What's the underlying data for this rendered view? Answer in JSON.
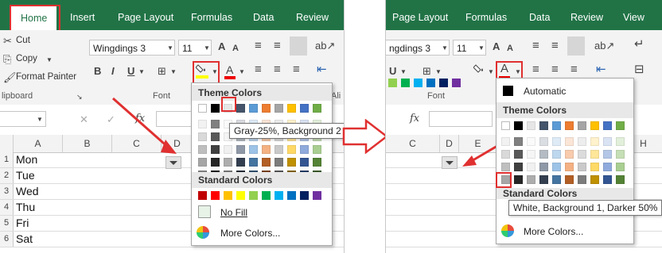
{
  "left": {
    "tabs": [
      "Home",
      "Insert",
      "Page Layout",
      "Formulas",
      "Data",
      "Review"
    ],
    "ribbon": {
      "cut": "Cut",
      "copy": "Copy",
      "format_painter": "Format Painter",
      "font_name": "Wingdings 3",
      "font_size": "11",
      "group_clipboard": "lipboard",
      "group_font": "Font",
      "group_align": "Ali"
    },
    "formula_bar": {
      "fx": "fx"
    },
    "columns": [
      "A",
      "B",
      "C",
      "D"
    ],
    "rows": [
      {
        "num": "1",
        "value": "Mon"
      },
      {
        "num": "2",
        "value": "Tue"
      },
      {
        "num": "3",
        "value": "Wed"
      },
      {
        "num": "4",
        "value": "Thu"
      },
      {
        "num": "5",
        "value": "Fri"
      },
      {
        "num": "6",
        "value": "Sat"
      }
    ],
    "fill_menu": {
      "theme_header": "Theme Colors",
      "standard_header": "Standard Colors",
      "no_fill": "No Fill",
      "more_colors": "More Colors...",
      "tooltip": "Gray-25%, Background 2"
    }
  },
  "right": {
    "tabs": [
      "Page Layout",
      "Formulas",
      "Data",
      "Review",
      "View"
    ],
    "ribbon": {
      "font_name": "ngdings 3",
      "font_size": "11",
      "group_font": "Font"
    },
    "formula_bar": {
      "fx": "fx"
    },
    "columns": [
      "C",
      "D",
      "E",
      "H"
    ],
    "font_menu": {
      "automatic": "Automatic",
      "theme_header": "Theme Colors",
      "standard_header": "Standard Colors",
      "more_colors": "More Colors...",
      "tooltip": "White, Background 1, Darker 50%"
    }
  },
  "colors": {
    "ribbon_green": "#217346",
    "highlight_red": "#e03030",
    "theme_base": [
      "#ffffff",
      "#000000",
      "#e7e6e6",
      "#44546a",
      "#5b9bd5",
      "#ed7d31",
      "#a5a5a5",
      "#ffc000",
      "#4472c4",
      "#70ad47"
    ],
    "standard": [
      "#c00000",
      "#ff0000",
      "#ffc000",
      "#ffff00",
      "#92d050",
      "#00b050",
      "#00b0f0",
      "#0070c0",
      "#002060",
      "#7030a0"
    ]
  }
}
